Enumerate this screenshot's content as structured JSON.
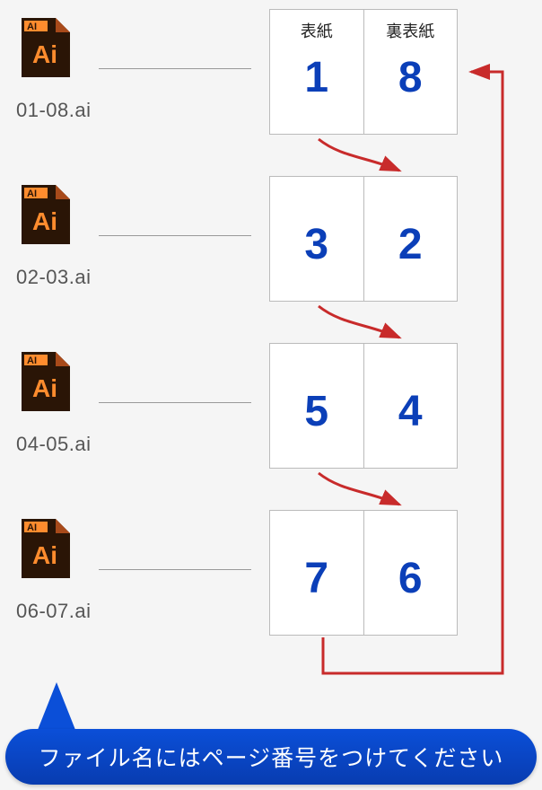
{
  "files": [
    {
      "name": "01-08.ai"
    },
    {
      "name": "02-03.ai"
    },
    {
      "name": "04-05.ai"
    },
    {
      "name": "06-07.ai"
    }
  ],
  "spreads": [
    {
      "left": {
        "header": "表紙",
        "num": "1"
      },
      "right": {
        "header": "裏表紙",
        "num": "8"
      }
    },
    {
      "left": {
        "header": "",
        "num": "3"
      },
      "right": {
        "header": "",
        "num": "2"
      }
    },
    {
      "left": {
        "header": "",
        "num": "5"
      },
      "right": {
        "header": "",
        "num": "4"
      }
    },
    {
      "left": {
        "header": "",
        "num": "7"
      },
      "right": {
        "header": "",
        "num": "6"
      }
    }
  ],
  "callout": "ファイル名にはページ番号をつけてください",
  "icon_label": "AI",
  "icon_text": "Ai",
  "colors": {
    "page_number": "#0b3fb8",
    "arrow": "#c82b2b",
    "callout_bg": "#0b4fd8"
  }
}
